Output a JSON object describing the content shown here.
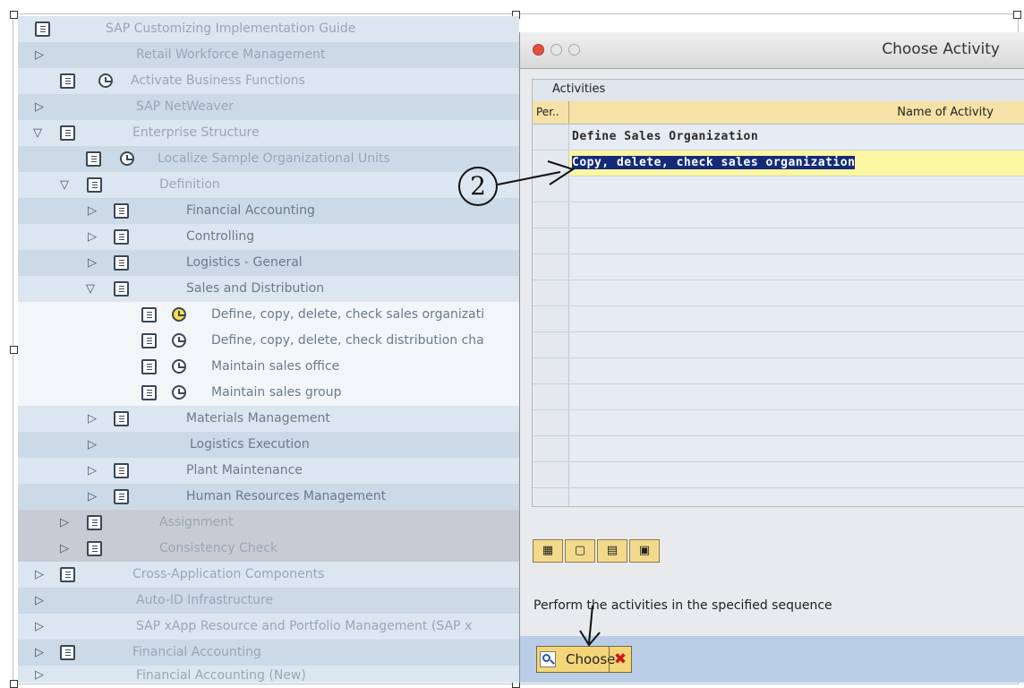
{
  "tree": {
    "rows": [
      {
        "label": "SAP Customizing Implementation Guide"
      },
      {
        "label": "Retail Workforce Management"
      },
      {
        "label": "Activate Business Functions"
      },
      {
        "label": "SAP NetWeaver"
      },
      {
        "label": "Enterprise Structure"
      },
      {
        "label": "Localize Sample Organizational Units"
      },
      {
        "label": "Definition"
      },
      {
        "label": "Financial Accounting"
      },
      {
        "label": "Controlling"
      },
      {
        "label": "Logistics - General"
      },
      {
        "label": "Sales and Distribution"
      },
      {
        "label": "Define, copy, delete, check sales organizati"
      },
      {
        "label": "Define, copy, delete, check distribution cha"
      },
      {
        "label": "Maintain sales office"
      },
      {
        "label": "Maintain sales group"
      },
      {
        "label": "Materials Management"
      },
      {
        "label": "Logistics Execution"
      },
      {
        "label": "Plant Maintenance"
      },
      {
        "label": "Human Resources Management"
      },
      {
        "label": "Assignment"
      },
      {
        "label": "Consistency Check"
      },
      {
        "label": "Cross-Application Components"
      },
      {
        "label": "Auto-ID Infrastructure"
      },
      {
        "label": "SAP xApp Resource and Portfolio Management (SAP x"
      },
      {
        "label": "Financial Accounting"
      },
      {
        "label": "Financial Accounting (New)"
      }
    ]
  },
  "dialog": {
    "title": "Choose Activity",
    "table_title": "Activities",
    "columns": {
      "per": "Per..",
      "name": "Name of Activity"
    },
    "rows": [
      "Define Sales Organization",
      "Copy, delete, check sales organization"
    ],
    "selected_row": 1,
    "toolbar_buttons": [
      "select-all",
      "deselect-all",
      "select-block",
      "details"
    ],
    "message": "Perform the activities in the specified sequence",
    "choose_label": "Choose",
    "cancel_symbol": "✖"
  },
  "annotation": {
    "step_label": "2"
  },
  "colors": {
    "highlight_bg": "#142b7a",
    "row_highlight": "#fbf6a0",
    "header": "#f6e2a6",
    "bottom_bar": "#b9cde6"
  }
}
